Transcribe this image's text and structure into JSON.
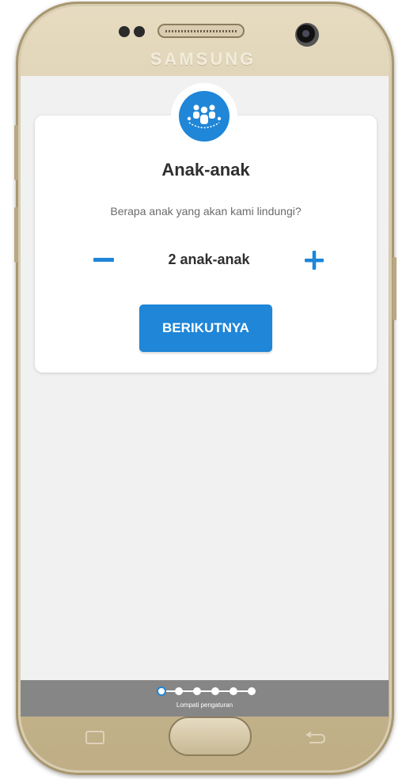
{
  "device": {
    "brand": "SAMSUNG"
  },
  "card": {
    "title": "Anak-anak",
    "subtitle": "Berapa anak yang akan kami lindungi?",
    "count_label": "2 anak-anak",
    "next_label": "BERIKUTNYA",
    "icon": "family-group-icon"
  },
  "footer": {
    "skip_label": "Lompati pengaturan",
    "steps_total": 6,
    "current_step": 1
  },
  "colors": {
    "accent": "#1f86d8",
    "screen_bg": "#f1f1f1",
    "footer_bg": "#868686"
  }
}
